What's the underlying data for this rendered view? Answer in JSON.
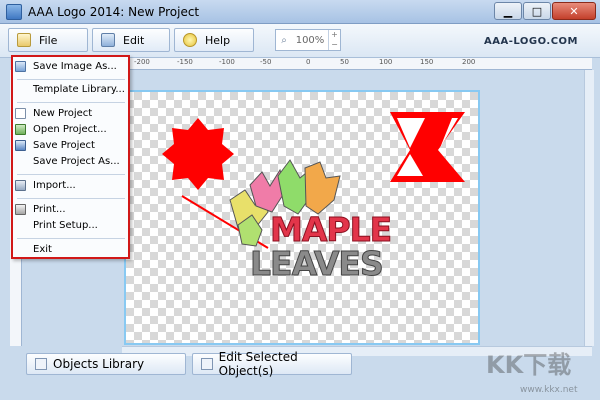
{
  "window": {
    "title": "AAA Logo 2014: New Project",
    "minimize": "▁",
    "maximize": "□",
    "close": "✕"
  },
  "toolbar": {
    "file_label": "File",
    "edit_label": "Edit",
    "help_label": "Help",
    "zoom_value": "100%",
    "zoom_up": "+",
    "zoom_down": "−",
    "brand": "AAA-LOGO.COM"
  },
  "ruler": {
    "top_ticks": [
      "-200",
      "-150",
      "-100",
      "-50",
      "0",
      "50",
      "100",
      "150",
      "200"
    ]
  },
  "file_menu": {
    "items": [
      {
        "label": "Save Image As...",
        "icon": "save-image-icon"
      },
      {
        "label": "Template Library...",
        "icon": ""
      },
      {
        "label": "New Project",
        "icon": "new-document-icon"
      },
      {
        "label": "Open Project...",
        "icon": "open-folder-icon"
      },
      {
        "label": "Save Project",
        "icon": "save-disk-icon"
      },
      {
        "label": "Save Project As...",
        "icon": ""
      },
      {
        "label": "Import...",
        "icon": "import-icon"
      },
      {
        "label": "Print...",
        "icon": "print-icon"
      },
      {
        "label": "Print Setup...",
        "icon": ""
      },
      {
        "label": "Exit",
        "icon": ""
      }
    ]
  },
  "logo": {
    "line1": "MAPLE",
    "line2": "LEAVES"
  },
  "bottom_tabs": {
    "objects_library": "Objects Library",
    "edit_selected": "Edit Selected Object(s)"
  },
  "watermark": {
    "text": "KK下载",
    "url": "www.kkx.net"
  },
  "colors": {
    "highlight_red": "#d11818",
    "shape_red": "#ff0000",
    "canvas_border": "#88c9f2",
    "workarea": "#c9daec"
  }
}
